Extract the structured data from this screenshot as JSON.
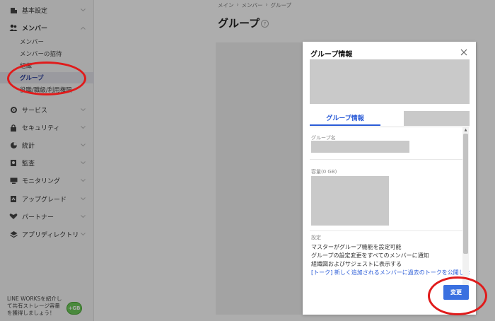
{
  "sidebar": {
    "items": [
      {
        "label": "基本設定",
        "icon": "building-icon"
      },
      {
        "label": "メンバー",
        "icon": "members-icon"
      },
      {
        "label": "サービス",
        "icon": "gear-icon"
      },
      {
        "label": "セキュリティ",
        "icon": "lock-icon"
      },
      {
        "label": "統計",
        "icon": "pie-chart-icon"
      },
      {
        "label": "監査",
        "icon": "audit-icon"
      },
      {
        "label": "モニタリング",
        "icon": "monitor-icon"
      },
      {
        "label": "アップグレード",
        "icon": "upgrade-icon"
      },
      {
        "label": "パートナー",
        "icon": "handshake-icon"
      },
      {
        "label": "アプリディレクトリ",
        "icon": "layers-icon"
      }
    ],
    "member_subitems": [
      {
        "label": "メンバー"
      },
      {
        "label": "メンバーの招待"
      },
      {
        "label": "組織"
      },
      {
        "label": "グループ"
      },
      {
        "label": "役職/職級/利用権限"
      }
    ],
    "promo": {
      "line1": "LINE WORKSを紹介し",
      "line2": "て共有ストレージ容量",
      "line3": "を獲得しましょう！",
      "badge": "+GB"
    }
  },
  "breadcrumb": [
    "メイン",
    "メンバー",
    "グループ"
  ],
  "page_title": "グループ",
  "modal": {
    "title": "グループ情報",
    "tab_active": "グループ情報",
    "group_name_label": "グループ名",
    "capacity_label": "容量(0 GB)",
    "settings_label": "設定",
    "settings_lines": [
      "マスターがグループ機能を設定可能",
      "グループの設定変更をすべてのメンバーに通知",
      "組織図およびサジェストに表示する"
    ],
    "settings_link": "[トーク] 新しく追加されるメンバーに過去のトークを公開しな",
    "change_button": "変更"
  },
  "colors": {
    "accent": "#2a5bd7",
    "button": "#3a70e0",
    "annotation": "#e01b1b"
  }
}
